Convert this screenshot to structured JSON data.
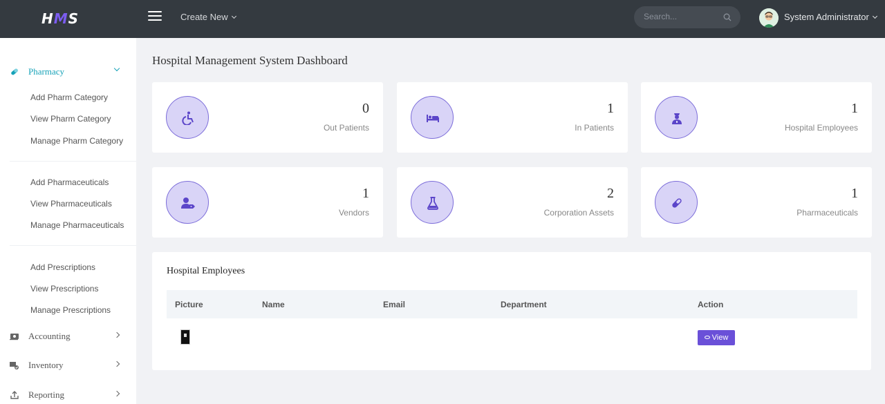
{
  "header": {
    "logo": [
      "H",
      "M",
      "S"
    ],
    "create_new": "Create New",
    "search_placeholder": "Search...",
    "user_name": "System Administrator"
  },
  "sidebar": {
    "pharmacy": "Pharmacy",
    "pharmacy_items": [
      "Add Pharm Category",
      "View Pharm Category",
      "Manage Pharm Category",
      "Add Pharmaceuticals",
      "View Pharmaceuticals",
      "Manage Pharmaceuticals",
      "Add Prescriptions",
      "View Prescriptions",
      "Manage Prescriptions"
    ],
    "accounting": "Accounting",
    "inventory": "Inventory",
    "reporting": "Reporting"
  },
  "main": {
    "title": "Hospital Management System Dashboard",
    "cards": [
      {
        "count": "0",
        "label": "Out Patients",
        "icon": "wheelchair-icon"
      },
      {
        "count": "1",
        "label": "In Patients",
        "icon": "bed-icon"
      },
      {
        "count": "1",
        "label": "Hospital Employees",
        "icon": "user-nurse-icon"
      },
      {
        "count": "1",
        "label": "Vendors",
        "icon": "user-tag-icon"
      },
      {
        "count": "2",
        "label": "Corporation Assets",
        "icon": "flask-icon"
      },
      {
        "count": "1",
        "label": "Pharmaceuticals",
        "icon": "pills-icon"
      }
    ],
    "employees_panel": {
      "title": "Hospital Employees",
      "columns": [
        "Picture",
        "Name",
        "Email",
        "Department",
        "Action"
      ],
      "row": {
        "view_label": "View"
      }
    }
  },
  "colors": {
    "topbar": "#343a40",
    "accent": "#6a50d8",
    "active_link": "#17a2b8",
    "icon_circle": "#d9d4f7"
  }
}
